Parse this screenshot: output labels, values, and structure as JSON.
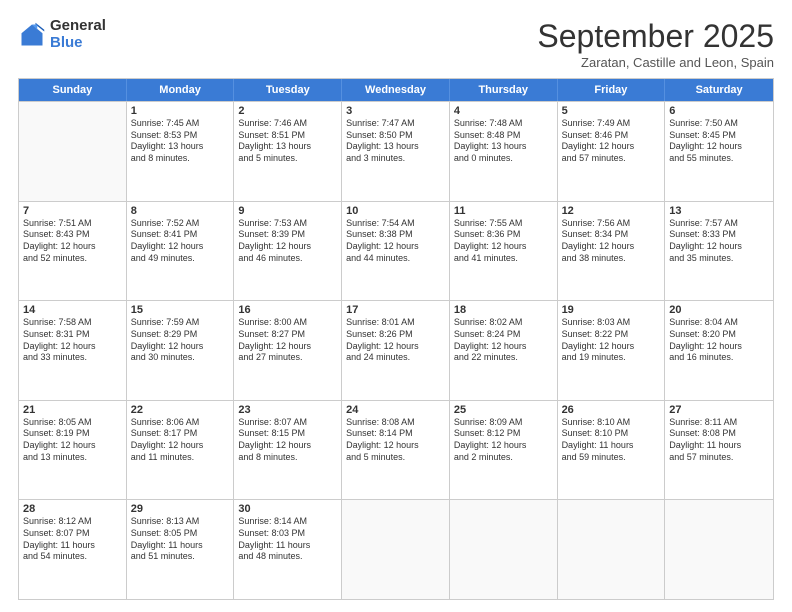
{
  "logo": {
    "general": "General",
    "blue": "Blue"
  },
  "title": "September 2025",
  "subtitle": "Zaratan, Castille and Leon, Spain",
  "header_days": [
    "Sunday",
    "Monday",
    "Tuesday",
    "Wednesday",
    "Thursday",
    "Friday",
    "Saturday"
  ],
  "weeks": [
    [
      {
        "day": "",
        "lines": []
      },
      {
        "day": "1",
        "lines": [
          "Sunrise: 7:45 AM",
          "Sunset: 8:53 PM",
          "Daylight: 13 hours",
          "and 8 minutes."
        ]
      },
      {
        "day": "2",
        "lines": [
          "Sunrise: 7:46 AM",
          "Sunset: 8:51 PM",
          "Daylight: 13 hours",
          "and 5 minutes."
        ]
      },
      {
        "day": "3",
        "lines": [
          "Sunrise: 7:47 AM",
          "Sunset: 8:50 PM",
          "Daylight: 13 hours",
          "and 3 minutes."
        ]
      },
      {
        "day": "4",
        "lines": [
          "Sunrise: 7:48 AM",
          "Sunset: 8:48 PM",
          "Daylight: 13 hours",
          "and 0 minutes."
        ]
      },
      {
        "day": "5",
        "lines": [
          "Sunrise: 7:49 AM",
          "Sunset: 8:46 PM",
          "Daylight: 12 hours",
          "and 57 minutes."
        ]
      },
      {
        "day": "6",
        "lines": [
          "Sunrise: 7:50 AM",
          "Sunset: 8:45 PM",
          "Daylight: 12 hours",
          "and 55 minutes."
        ]
      }
    ],
    [
      {
        "day": "7",
        "lines": [
          "Sunrise: 7:51 AM",
          "Sunset: 8:43 PM",
          "Daylight: 12 hours",
          "and 52 minutes."
        ]
      },
      {
        "day": "8",
        "lines": [
          "Sunrise: 7:52 AM",
          "Sunset: 8:41 PM",
          "Daylight: 12 hours",
          "and 49 minutes."
        ]
      },
      {
        "day": "9",
        "lines": [
          "Sunrise: 7:53 AM",
          "Sunset: 8:39 PM",
          "Daylight: 12 hours",
          "and 46 minutes."
        ]
      },
      {
        "day": "10",
        "lines": [
          "Sunrise: 7:54 AM",
          "Sunset: 8:38 PM",
          "Daylight: 12 hours",
          "and 44 minutes."
        ]
      },
      {
        "day": "11",
        "lines": [
          "Sunrise: 7:55 AM",
          "Sunset: 8:36 PM",
          "Daylight: 12 hours",
          "and 41 minutes."
        ]
      },
      {
        "day": "12",
        "lines": [
          "Sunrise: 7:56 AM",
          "Sunset: 8:34 PM",
          "Daylight: 12 hours",
          "and 38 minutes."
        ]
      },
      {
        "day": "13",
        "lines": [
          "Sunrise: 7:57 AM",
          "Sunset: 8:33 PM",
          "Daylight: 12 hours",
          "and 35 minutes."
        ]
      }
    ],
    [
      {
        "day": "14",
        "lines": [
          "Sunrise: 7:58 AM",
          "Sunset: 8:31 PM",
          "Daylight: 12 hours",
          "and 33 minutes."
        ]
      },
      {
        "day": "15",
        "lines": [
          "Sunrise: 7:59 AM",
          "Sunset: 8:29 PM",
          "Daylight: 12 hours",
          "and 30 minutes."
        ]
      },
      {
        "day": "16",
        "lines": [
          "Sunrise: 8:00 AM",
          "Sunset: 8:27 PM",
          "Daylight: 12 hours",
          "and 27 minutes."
        ]
      },
      {
        "day": "17",
        "lines": [
          "Sunrise: 8:01 AM",
          "Sunset: 8:26 PM",
          "Daylight: 12 hours",
          "and 24 minutes."
        ]
      },
      {
        "day": "18",
        "lines": [
          "Sunrise: 8:02 AM",
          "Sunset: 8:24 PM",
          "Daylight: 12 hours",
          "and 22 minutes."
        ]
      },
      {
        "day": "19",
        "lines": [
          "Sunrise: 8:03 AM",
          "Sunset: 8:22 PM",
          "Daylight: 12 hours",
          "and 19 minutes."
        ]
      },
      {
        "day": "20",
        "lines": [
          "Sunrise: 8:04 AM",
          "Sunset: 8:20 PM",
          "Daylight: 12 hours",
          "and 16 minutes."
        ]
      }
    ],
    [
      {
        "day": "21",
        "lines": [
          "Sunrise: 8:05 AM",
          "Sunset: 8:19 PM",
          "Daylight: 12 hours",
          "and 13 minutes."
        ]
      },
      {
        "day": "22",
        "lines": [
          "Sunrise: 8:06 AM",
          "Sunset: 8:17 PM",
          "Daylight: 12 hours",
          "and 11 minutes."
        ]
      },
      {
        "day": "23",
        "lines": [
          "Sunrise: 8:07 AM",
          "Sunset: 8:15 PM",
          "Daylight: 12 hours",
          "and 8 minutes."
        ]
      },
      {
        "day": "24",
        "lines": [
          "Sunrise: 8:08 AM",
          "Sunset: 8:14 PM",
          "Daylight: 12 hours",
          "and 5 minutes."
        ]
      },
      {
        "day": "25",
        "lines": [
          "Sunrise: 8:09 AM",
          "Sunset: 8:12 PM",
          "Daylight: 12 hours",
          "and 2 minutes."
        ]
      },
      {
        "day": "26",
        "lines": [
          "Sunrise: 8:10 AM",
          "Sunset: 8:10 PM",
          "Daylight: 11 hours",
          "and 59 minutes."
        ]
      },
      {
        "day": "27",
        "lines": [
          "Sunrise: 8:11 AM",
          "Sunset: 8:08 PM",
          "Daylight: 11 hours",
          "and 57 minutes."
        ]
      }
    ],
    [
      {
        "day": "28",
        "lines": [
          "Sunrise: 8:12 AM",
          "Sunset: 8:07 PM",
          "Daylight: 11 hours",
          "and 54 minutes."
        ]
      },
      {
        "day": "29",
        "lines": [
          "Sunrise: 8:13 AM",
          "Sunset: 8:05 PM",
          "Daylight: 11 hours",
          "and 51 minutes."
        ]
      },
      {
        "day": "30",
        "lines": [
          "Sunrise: 8:14 AM",
          "Sunset: 8:03 PM",
          "Daylight: 11 hours",
          "and 48 minutes."
        ]
      },
      {
        "day": "",
        "lines": []
      },
      {
        "day": "",
        "lines": []
      },
      {
        "day": "",
        "lines": []
      },
      {
        "day": "",
        "lines": []
      }
    ]
  ]
}
